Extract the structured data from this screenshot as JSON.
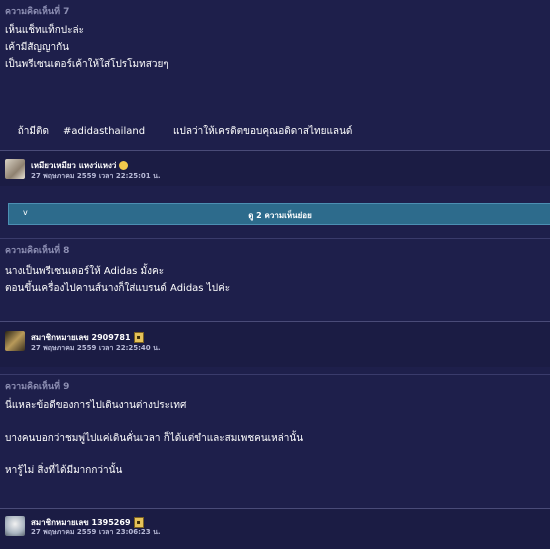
{
  "comments": [
    {
      "title": "ความคิดเห็นที่ 7",
      "lines": [
        "เห็นแช็ทแท็กปะล่ะ",
        "เค้ามีสัญญากัน",
        "เป็นพรีเซนเตอร์เค้าให้ใส่โปรโมทสวยๆ"
      ],
      "extra": {
        "left": "ถ้ามีติด",
        "hashtag": "#adidasthailand",
        "right": "แปลว่าให้เครดิตขอบคุณอดิดาสไทยแลนด์"
      },
      "user": "เหมียวเหมียว แหงว่แหงว่",
      "meta": "27 พฤษภาคม 2559 เวลา 22:25:01 น."
    },
    {
      "title": "ความคิดเห็นที่ 8",
      "lines": [
        "นางเป็นพรีเซนเตอร์ให้ Adidas มั้งคะ",
        "ตอนขึ้นเครื่องไปคานส์นางก็ใส่แบรนด์ Adidas ไปค่ะ"
      ],
      "user": "สมาชิกหมายเลข 2909781",
      "meta": "27 พฤษภาคม 2559 เวลา 22:25:40 น."
    },
    {
      "title": "ความคิดเห็นที่ 9",
      "lines": [
        "นี่แหละข้อดีของการไปเดินงานต่างประเทศ",
        "บางคนบอกว่าชมพู่ไปแค่เดินคั่นเวลา ก็ได้แต่ขำและสมเพชคนเหล่านั้น",
        "หารู้ไม่ สิ่งที่ได้มีมากกว่านั้น"
      ],
      "user": "สมาชิกหมายเลข 1395269",
      "meta": "27 พฤษภาคม 2559 เวลา 23:06:23 น."
    }
  ],
  "replies": {
    "chevron": "v",
    "label": "ดู 2 ความเห็นย่อย"
  },
  "colors": {
    "background": "#1e1f4b",
    "reply_bar": "#2d6b8c",
    "title": "#8d8fb3"
  }
}
